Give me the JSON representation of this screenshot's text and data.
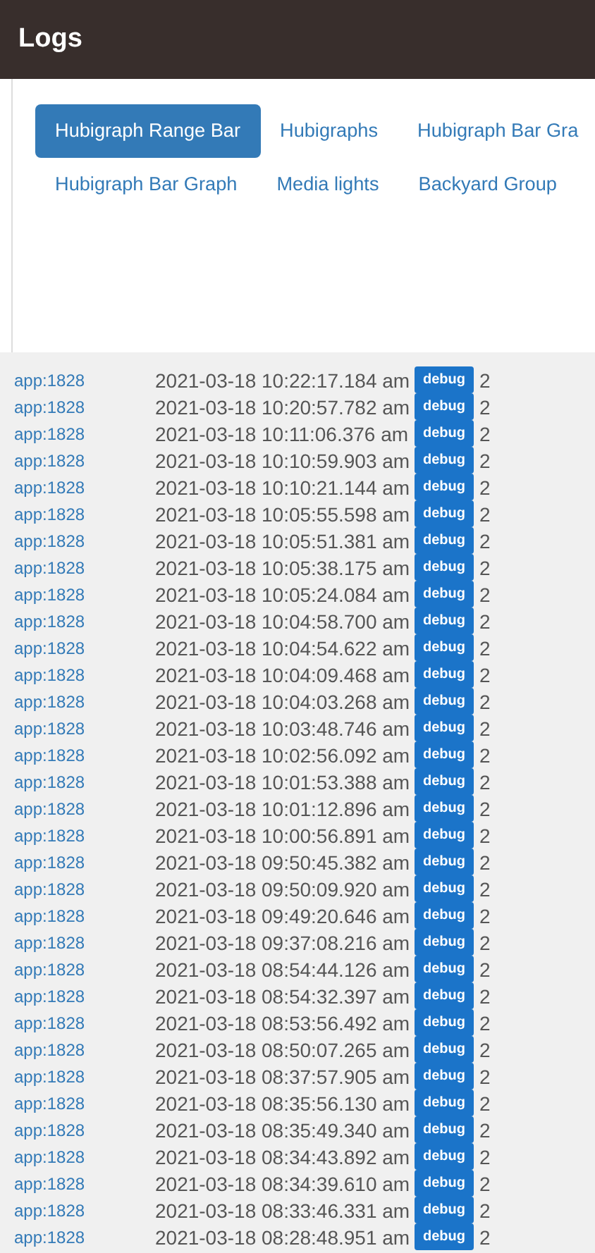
{
  "header": {
    "title": "Logs"
  },
  "tabs": [
    [
      {
        "label": "Hubigraph Range Bar",
        "selected": true
      },
      {
        "label": "Hubigraphs",
        "selected": false
      },
      {
        "label": "Hubigraph Bar Gra",
        "selected": false
      }
    ],
    [
      {
        "label": "Hubigraph Bar Graph",
        "selected": false
      },
      {
        "label": "Media lights",
        "selected": false
      },
      {
        "label": "Backyard Group",
        "selected": false
      }
    ]
  ],
  "log_rows": [
    {
      "source": "app:1828",
      "time": "2021-03-18 10:22:17.184 am",
      "level": "debug",
      "message": "2"
    },
    {
      "source": "app:1828",
      "time": "2021-03-18 10:20:57.782 am",
      "level": "debug",
      "message": "2"
    },
    {
      "source": "app:1828",
      "time": "2021-03-18 10:11:06.376 am",
      "level": "debug",
      "message": "2"
    },
    {
      "source": "app:1828",
      "time": "2021-03-18 10:10:59.903 am",
      "level": "debug",
      "message": "2"
    },
    {
      "source": "app:1828",
      "time": "2021-03-18 10:10:21.144 am",
      "level": "debug",
      "message": "2"
    },
    {
      "source": "app:1828",
      "time": "2021-03-18 10:05:55.598 am",
      "level": "debug",
      "message": "2"
    },
    {
      "source": "app:1828",
      "time": "2021-03-18 10:05:51.381 am",
      "level": "debug",
      "message": "2"
    },
    {
      "source": "app:1828",
      "time": "2021-03-18 10:05:38.175 am",
      "level": "debug",
      "message": "2"
    },
    {
      "source": "app:1828",
      "time": "2021-03-18 10:05:24.084 am",
      "level": "debug",
      "message": "2"
    },
    {
      "source": "app:1828",
      "time": "2021-03-18 10:04:58.700 am",
      "level": "debug",
      "message": "2"
    },
    {
      "source": "app:1828",
      "time": "2021-03-18 10:04:54.622 am",
      "level": "debug",
      "message": "2"
    },
    {
      "source": "app:1828",
      "time": "2021-03-18 10:04:09.468 am",
      "level": "debug",
      "message": "2"
    },
    {
      "source": "app:1828",
      "time": "2021-03-18 10:04:03.268 am",
      "level": "debug",
      "message": "2"
    },
    {
      "source": "app:1828",
      "time": "2021-03-18 10:03:48.746 am",
      "level": "debug",
      "message": "2"
    },
    {
      "source": "app:1828",
      "time": "2021-03-18 10:02:56.092 am",
      "level": "debug",
      "message": "2"
    },
    {
      "source": "app:1828",
      "time": "2021-03-18 10:01:53.388 am",
      "level": "debug",
      "message": "2"
    },
    {
      "source": "app:1828",
      "time": "2021-03-18 10:01:12.896 am",
      "level": "debug",
      "message": "2"
    },
    {
      "source": "app:1828",
      "time": "2021-03-18 10:00:56.891 am",
      "level": "debug",
      "message": "2"
    },
    {
      "source": "app:1828",
      "time": "2021-03-18 09:50:45.382 am",
      "level": "debug",
      "message": "2"
    },
    {
      "source": "app:1828",
      "time": "2021-03-18 09:50:09.920 am",
      "level": "debug",
      "message": "2"
    },
    {
      "source": "app:1828",
      "time": "2021-03-18 09:49:20.646 am",
      "level": "debug",
      "message": "2"
    },
    {
      "source": "app:1828",
      "time": "2021-03-18 09:37:08.216 am",
      "level": "debug",
      "message": "2"
    },
    {
      "source": "app:1828",
      "time": "2021-03-18 08:54:44.126 am",
      "level": "debug",
      "message": "2"
    },
    {
      "source": "app:1828",
      "time": "2021-03-18 08:54:32.397 am",
      "level": "debug",
      "message": "2"
    },
    {
      "source": "app:1828",
      "time": "2021-03-18 08:53:56.492 am",
      "level": "debug",
      "message": "2"
    },
    {
      "source": "app:1828",
      "time": "2021-03-18 08:50:07.265 am",
      "level": "debug",
      "message": "2"
    },
    {
      "source": "app:1828",
      "time": "2021-03-18 08:37:57.905 am",
      "level": "debug",
      "message": "2"
    },
    {
      "source": "app:1828",
      "time": "2021-03-18 08:35:56.130 am",
      "level": "debug",
      "message": "2"
    },
    {
      "source": "app:1828",
      "time": "2021-03-18 08:35:49.340 am",
      "level": "debug",
      "message": "2"
    },
    {
      "source": "app:1828",
      "time": "2021-03-18 08:34:43.892 am",
      "level": "debug",
      "message": "2"
    },
    {
      "source": "app:1828",
      "time": "2021-03-18 08:34:39.610 am",
      "level": "debug",
      "message": "2"
    },
    {
      "source": "app:1828",
      "time": "2021-03-18 08:33:46.331 am",
      "level": "debug",
      "message": "2"
    },
    {
      "source": "app:1828",
      "time": "2021-03-18 08:28:48.951 am",
      "level": "debug",
      "message": "2"
    }
  ]
}
